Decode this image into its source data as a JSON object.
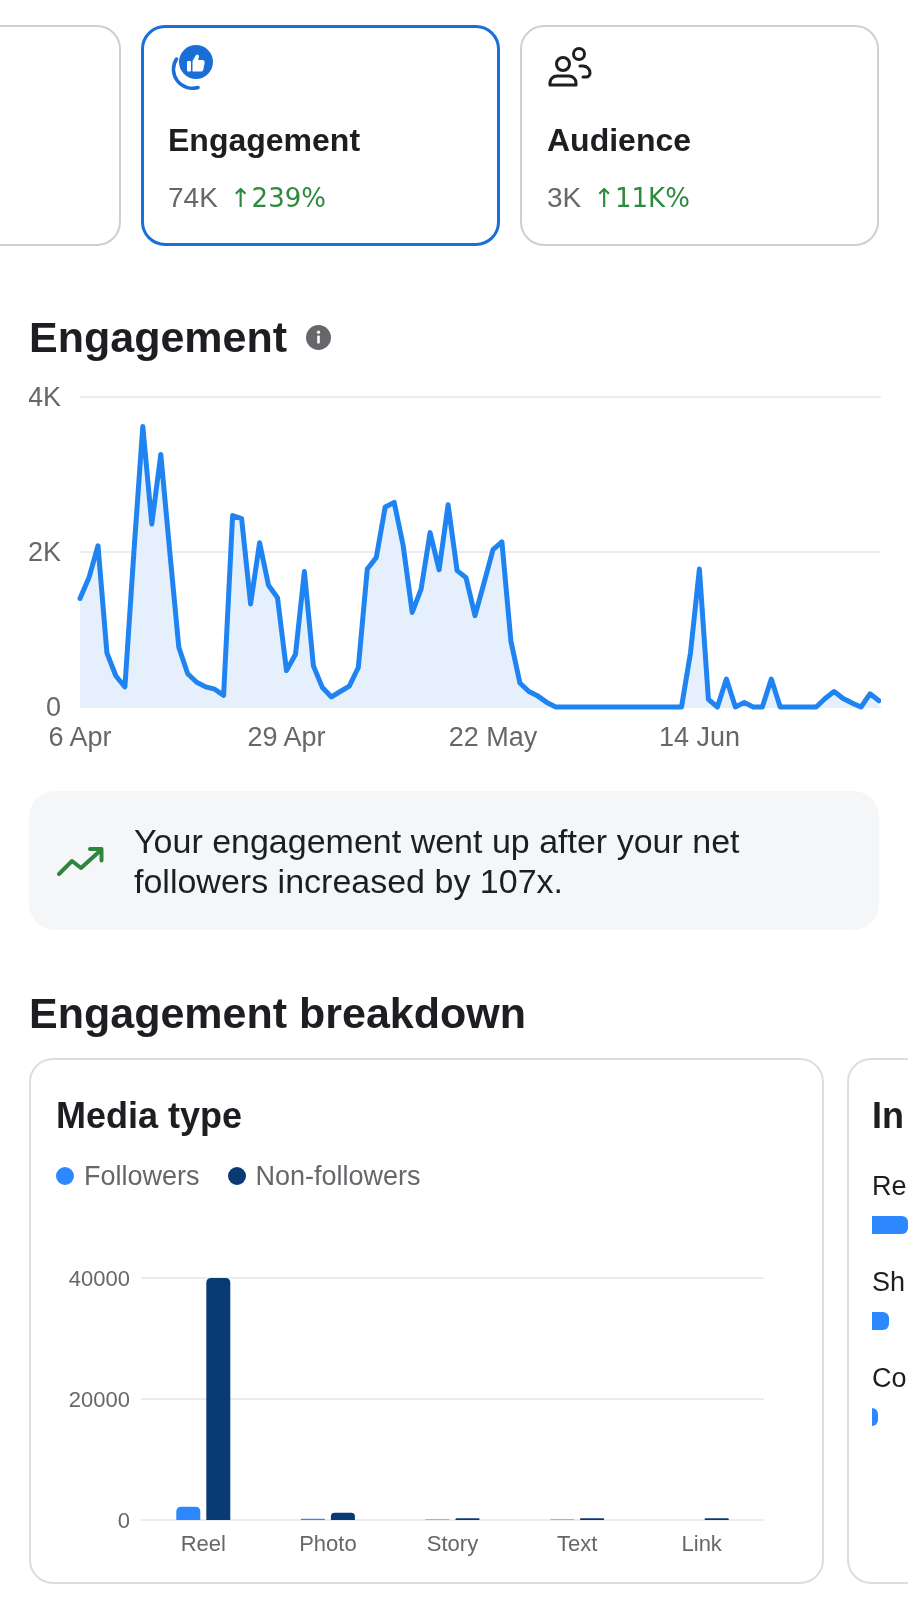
{
  "metric_cards": [
    {
      "selected": false
    },
    {
      "label": "Engagement",
      "value": "74K",
      "change": "↑239%",
      "selected": true
    },
    {
      "label": "Audience",
      "value": "3K",
      "change": "↑11K%",
      "selected": false
    }
  ],
  "engagement": {
    "title": "Engagement",
    "chart_data": {
      "type": "area",
      "ylim": [
        0,
        4000
      ],
      "yticks": [
        {
          "value": 0,
          "label": "0"
        },
        {
          "value": 2000,
          "label": "2K"
        },
        {
          "value": 4000,
          "label": "4K"
        }
      ],
      "categories": [
        "6 Apr",
        null,
        null,
        null,
        null,
        null,
        null,
        null,
        null,
        null,
        null,
        null,
        null,
        null,
        null,
        null,
        null,
        null,
        null,
        null,
        null,
        null,
        null,
        "29 Apr",
        null,
        null,
        null,
        null,
        null,
        null,
        null,
        null,
        null,
        null,
        null,
        null,
        null,
        null,
        null,
        null,
        null,
        null,
        null,
        null,
        null,
        null,
        "22 May",
        null,
        null,
        null,
        null,
        null,
        null,
        null,
        null,
        null,
        null,
        null,
        null,
        null,
        null,
        null,
        null,
        null,
        null,
        null,
        null,
        null,
        null,
        "14 Jun",
        null,
        null,
        null,
        null,
        null,
        null,
        null,
        null,
        null,
        null,
        null,
        null,
        null,
        null,
        null,
        null,
        null,
        null,
        null,
        null
      ],
      "values": [
        1400,
        1670,
        2080,
        700,
        400,
        260,
        2000,
        3620,
        2360,
        3260,
        2000,
        770,
        430,
        320,
        260,
        230,
        150,
        2470,
        2430,
        1330,
        2120,
        1570,
        1410,
        470,
        680,
        1750,
        530,
        250,
        130,
        200,
        270,
        510,
        1780,
        1930,
        2580,
        2640,
        2080,
        1220,
        1520,
        2250,
        1770,
        2610,
        1760,
        1670,
        1180,
        1600,
        2030,
        2130,
        850,
        310,
        200,
        140,
        60,
        0,
        0,
        0,
        0,
        0,
        0,
        0,
        0,
        0,
        0,
        0,
        0,
        0,
        0,
        0,
        700,
        1780,
        100,
        0,
        360,
        0,
        60,
        0,
        0,
        360,
        0,
        0,
        0,
        0,
        0,
        110,
        200,
        110,
        50,
        0,
        170,
        80
      ]
    },
    "insight": "Your engagement went up after your net followers increased by 107x."
  },
  "breakdown": {
    "title": "Engagement breakdown",
    "cards": [
      {
        "kind": "chart",
        "title": "Media type",
        "chart_data": {
          "type": "bar",
          "categories": [
            "Reel",
            "Photo",
            "Story",
            "Text",
            "Link"
          ],
          "series": [
            {
              "name": "Followers",
              "color": "#2d88ff",
              "values": [
                2200,
                200,
                100,
                100,
                0
              ]
            },
            {
              "name": "Non-followers",
              "color": "#0a3a73",
              "values": [
                40000,
                1200,
                300,
                300,
                300
              ]
            }
          ],
          "ylim": [
            0,
            40000
          ],
          "yticks": [
            0,
            20000,
            40000
          ]
        }
      },
      {
        "kind": "bars",
        "title": "In",
        "rows": [
          {
            "label": "Re"
          },
          {
            "label": "Sh"
          },
          {
            "label": "Co"
          }
        ]
      }
    ]
  }
}
